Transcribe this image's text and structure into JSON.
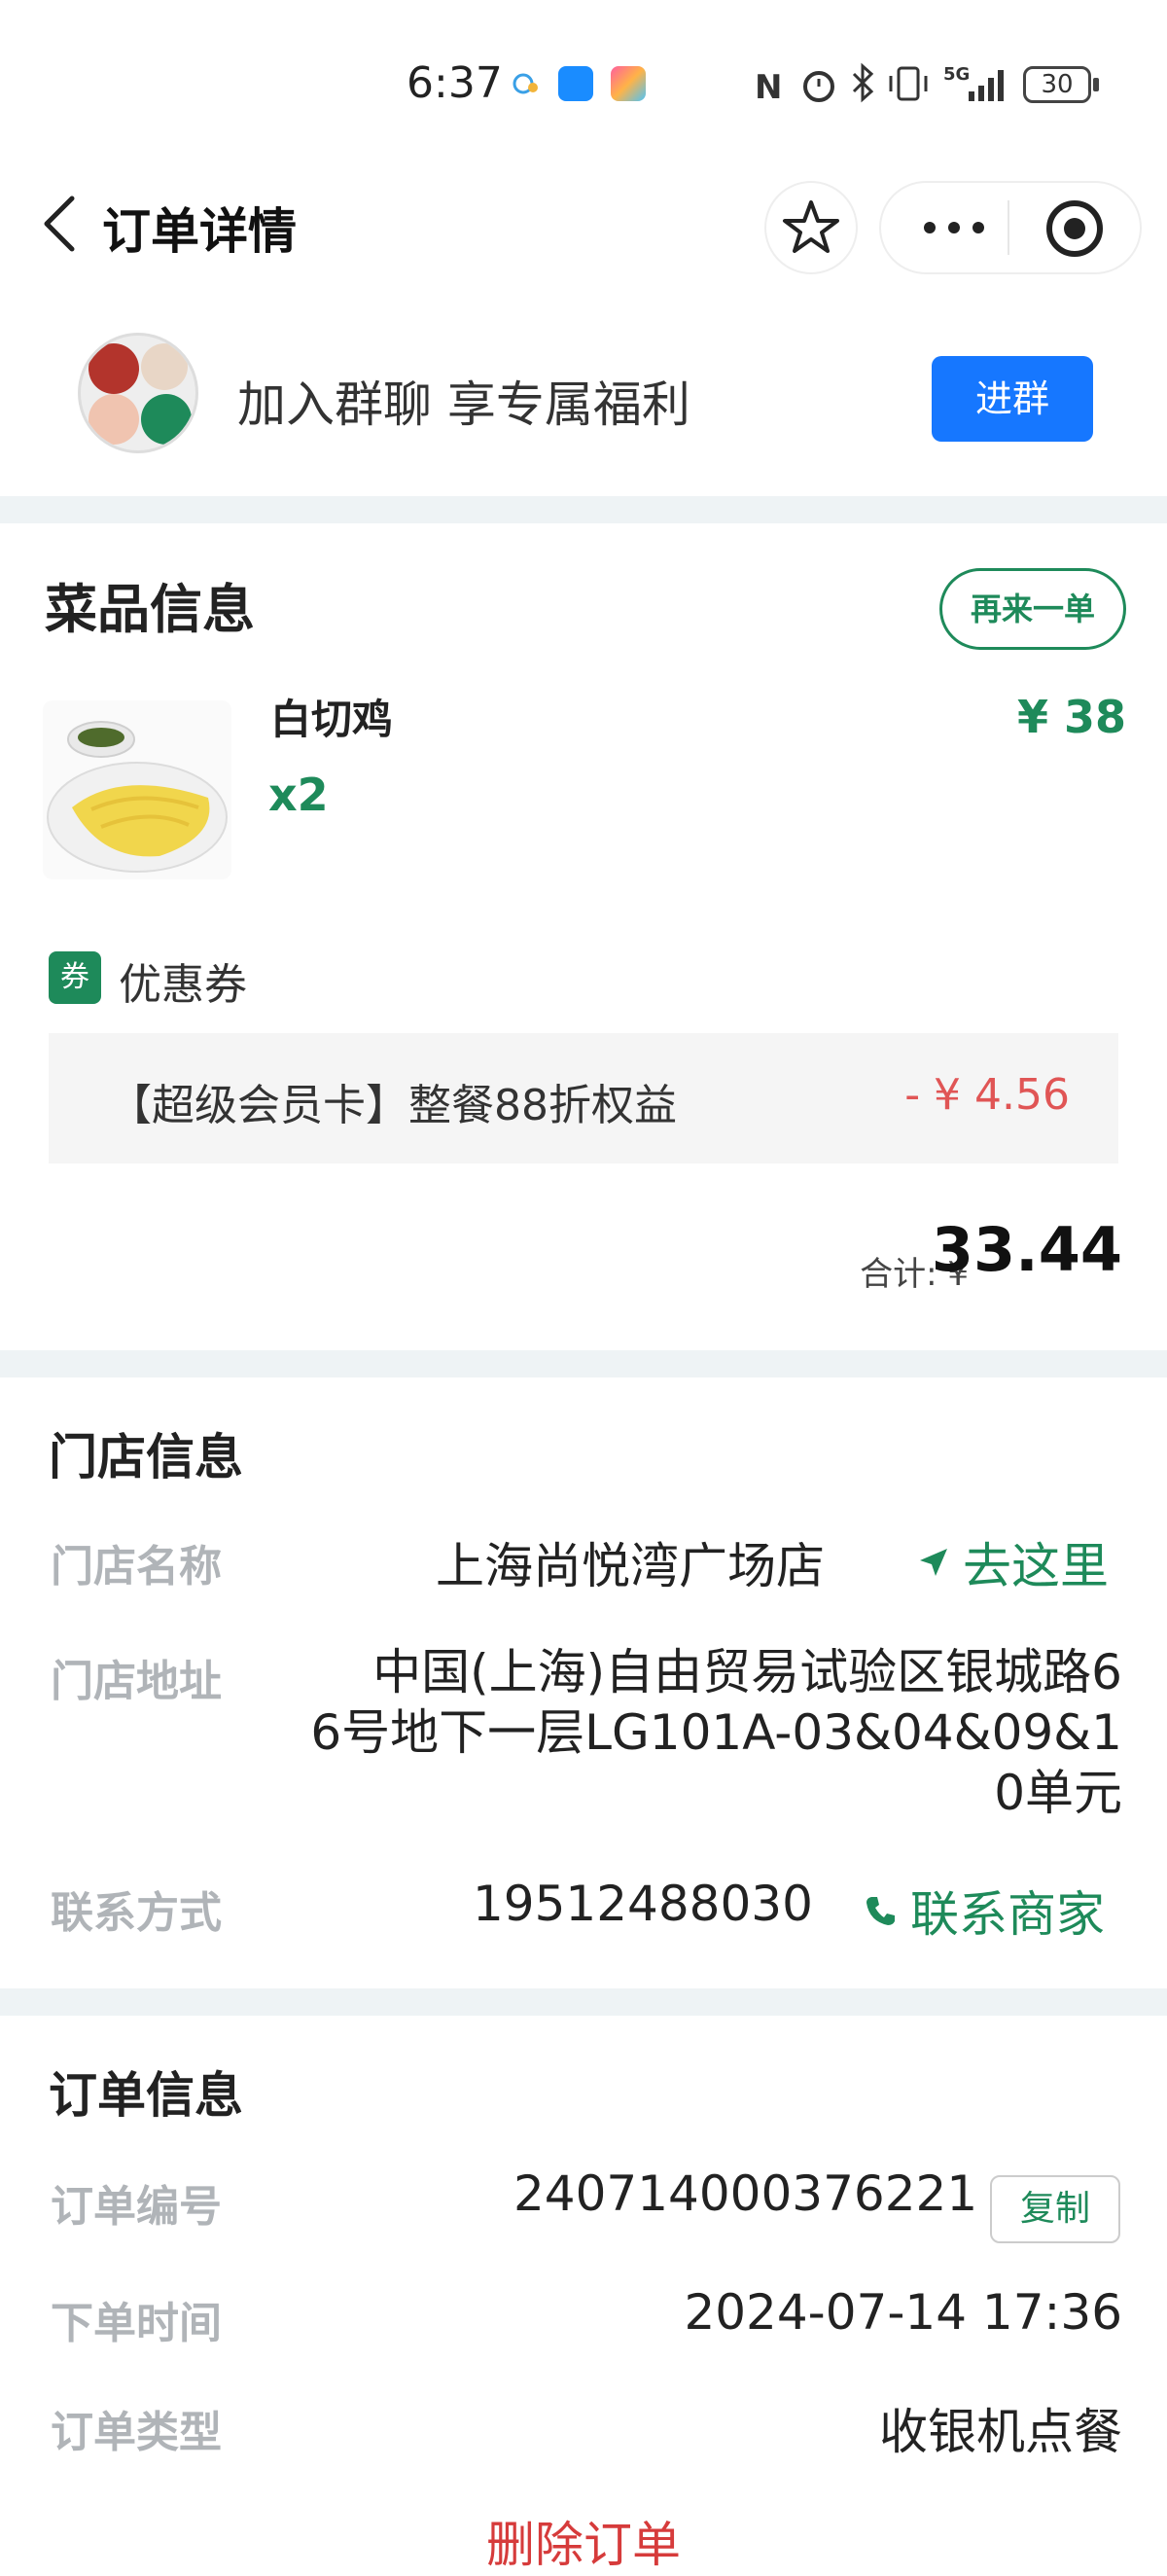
{
  "status_bar": {
    "time": "6:37",
    "network": "5G",
    "battery": "30"
  },
  "nav": {
    "title": "订单详情"
  },
  "group_banner": {
    "text": "加入群聊 享专属福利",
    "join_label": "进群"
  },
  "dish_section": {
    "title": "菜品信息",
    "reorder_label": "再来一单",
    "item": {
      "name": "白切鸡",
      "quantity": "x2",
      "price": "¥ 38"
    },
    "coupon": {
      "tag": "券",
      "label": "优惠券",
      "name": "【超级会员卡】整餐88折权益",
      "amount": "- ¥ 4.56"
    },
    "total": {
      "label": "合计: ¥",
      "value": "33.44"
    }
  },
  "store_section": {
    "title": "门店信息",
    "name_label": "门店名称",
    "name_value": "上海尚悦湾广场店",
    "navigate_label": "去这里",
    "address_label": "门店地址",
    "address_lines": [
      "中国(上海)自由贸易试验区银城路6",
      "6号地下一层LG101A-03&04&09&1",
      "0单元"
    ],
    "contact_label": "联系方式",
    "contact_value": "19512488030",
    "contact_action": "联系商家"
  },
  "order_section": {
    "title": "订单信息",
    "number_label": "订单编号",
    "number_value": "240714000376221",
    "copy_label": "复制",
    "time_label": "下单时间",
    "time_value": "2024-07-14 17:36",
    "type_label": "订单类型",
    "type_value": "收银机点餐"
  },
  "delete_label": "删除订单",
  "colors": {
    "accent_green": "#1e8a5a",
    "primary_blue": "#1677ff",
    "discount_red": "#e05555",
    "delete_red": "#d63b3b"
  }
}
